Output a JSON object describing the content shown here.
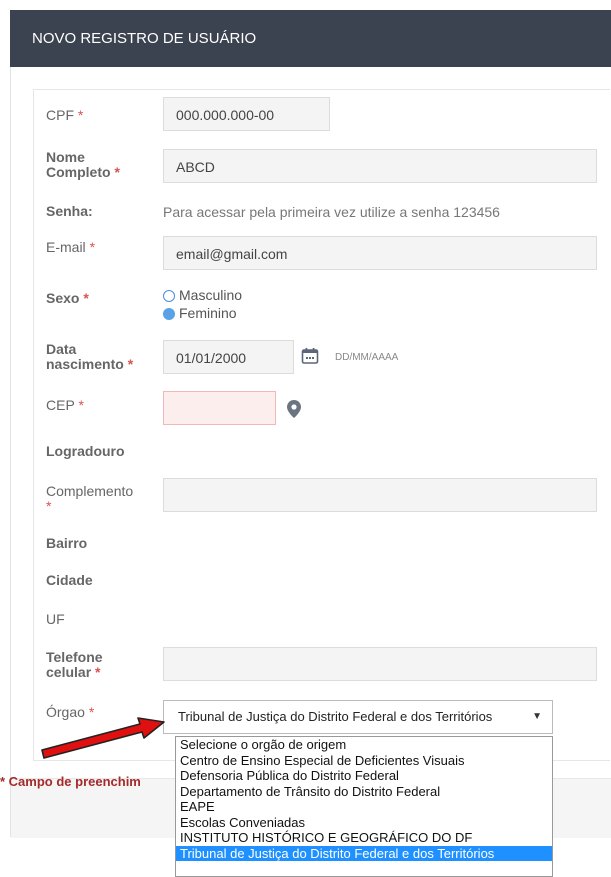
{
  "header": {
    "title": "NOVO REGISTRO DE USUÁRIO"
  },
  "form": {
    "cpf": {
      "label": "CPF",
      "value": "000.000.000-00"
    },
    "nome": {
      "label_line1": "Nome",
      "label_line2": "Completo",
      "value": "ABCD"
    },
    "senha": {
      "label": "Senha:",
      "hint": "Para acessar pela primeira vez utilize a senha 123456"
    },
    "email": {
      "label": "E-mail",
      "value": "email@gmail.com"
    },
    "sexo": {
      "label": "Sexo",
      "options": [
        "Masculino",
        "Feminino"
      ],
      "selected": "Feminino"
    },
    "data_nascimento": {
      "label_line1": "Data",
      "label_line2": "nascimento",
      "value": "01/01/2000",
      "format_hint": "DD/MM/AAAA"
    },
    "cep": {
      "label": "CEP",
      "value": ""
    },
    "logradouro": {
      "label": "Logradouro"
    },
    "complemento": {
      "label_line1": "Complemento",
      "value": ""
    },
    "bairro": {
      "label": "Bairro"
    },
    "cidade": {
      "label": "Cidade"
    },
    "uf": {
      "label": "UF"
    },
    "telefone": {
      "label_line1": "Telefone",
      "label_line2": "celular",
      "value": ""
    },
    "orgao": {
      "label": "Órgao",
      "selected": "Tribunal de Justiça do Distrito Federal e dos Territórios",
      "options": [
        "Selecione o orgão de origem",
        "Centro de Ensino Especial de Deficientes Visuais",
        "Defensoria Pública do Distrito Federal",
        "Departamento de Trânsito do Distrito Federal",
        "EAPE",
        "Escolas Conveniadas",
        "INSTITUTO HISTÓRICO E GEOGRÁFICO DO DF",
        "Tribunal de Justiça do Distrito Federal e dos Territórios"
      ]
    },
    "required_mark": "*"
  },
  "footnote": "* Campo de preenchim",
  "colors": {
    "header_bg": "#3b4250",
    "accent": "#5aa2e6",
    "required": "#d9534f",
    "selected_option": "#1e90ff",
    "arrow": "#e01010"
  }
}
